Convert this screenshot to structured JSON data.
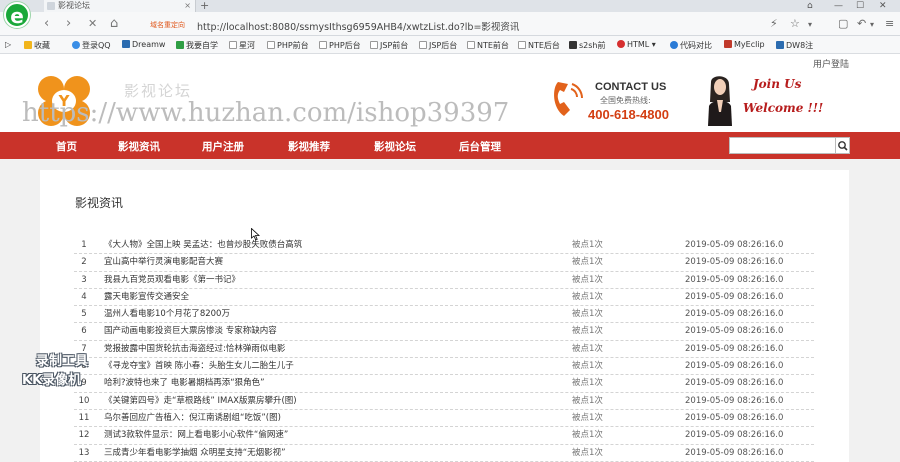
{
  "browser": {
    "logo_glyph": "e",
    "tab_title": "影视论坛",
    "tab_close": "×",
    "new_tab": "+",
    "window_controls": [
      "⌂",
      "—",
      "☐",
      "✕"
    ],
    "nav": {
      "back": "‹",
      "forward": "›",
      "stop": "✕",
      "home": "⌂"
    },
    "secure_badge": "域名重定向",
    "url": "http://localhost:8080/ssmysIthsg6959AHB4/xwtzList.do?lb=影视资讯",
    "toolbar_icons": [
      "⚡",
      "☆",
      "▾",
      "▢",
      "↶",
      "▾",
      "≡"
    ],
    "bookmarks": [
      {
        "label": "收藏",
        "color": "#f1b51c"
      },
      {
        "label": "登录QQ",
        "color": "#3a8ee6"
      },
      {
        "label": "Dreamw",
        "color": "#2b6cb0"
      },
      {
        "label": "我要自学",
        "color": "#2f9e44"
      },
      {
        "label": "星河",
        "color": "#999999"
      },
      {
        "label": "PHP前台",
        "color": "#999999"
      },
      {
        "label": "PHP后台",
        "color": "#999999"
      },
      {
        "label": "JSP前台",
        "color": "#999999"
      },
      {
        "label": "JSP后台",
        "color": "#999999"
      },
      {
        "label": "NTE前台",
        "color": "#999999"
      },
      {
        "label": "NTE后台",
        "color": "#999999"
      },
      {
        "label": "s2sh前",
        "color": "#333333"
      },
      {
        "label": "HTML",
        "color": "#d62f2f"
      },
      {
        "label": "代码对比",
        "color": "#2b7bd6"
      },
      {
        "label": "MyEclip",
        "color": "#c0392b"
      },
      {
        "label": "DW8注",
        "color": "#2b6cb0"
      }
    ]
  },
  "header": {
    "login_link": "用户登陆",
    "site_title": "影视论坛",
    "logo_char": "Y",
    "watermark": "https://www.huzhan.com/ishop39397",
    "contact_title": "CONTACT US",
    "contact_sub": "全国免费热线:",
    "contact_phone": "400-618-4800",
    "join_title": "Join Us",
    "welcome_title": "Welcome !!!"
  },
  "nav": {
    "items": [
      "首页",
      "影视资讯",
      "用户注册",
      "影视推荐",
      "影视论坛",
      "后台管理"
    ],
    "search_placeholder": "",
    "search_icon": "⚲"
  },
  "content": {
    "section_title": "影视资讯",
    "rows": [
      {
        "no": "1",
        "title": "《大人物》全国上映 吴孟达：也曾炒股失败债台高筑",
        "hits": "被点1次",
        "time": "2019-05-09 08:26:16.0"
      },
      {
        "no": "2",
        "title": "宜山高中举行灵演电影配音大赛",
        "hits": "被点1次",
        "time": "2019-05-09 08:26:16.0"
      },
      {
        "no": "3",
        "title": "我县九百党员观看电影《第一书记》",
        "hits": "被点1次",
        "time": "2019-05-09 08:26:16.0"
      },
      {
        "no": "4",
        "title": "露天电影宣传交通安全",
        "hits": "被点1次",
        "time": "2019-05-09 08:26:16.0"
      },
      {
        "no": "5",
        "title": "温州人看电影10个月花了8200万",
        "hits": "被点1次",
        "time": "2019-05-09 08:26:16.0"
      },
      {
        "no": "6",
        "title": "国产动画电影投资巨大票房惨淡 专家称缺内容",
        "hits": "被点1次",
        "time": "2019-05-09 08:26:16.0"
      },
      {
        "no": "7",
        "title": "党报披露中国货轮抗击海盗经过:恰林弹雨似电影",
        "hits": "被点1次",
        "time": "2019-05-09 08:26:16.0"
      },
      {
        "no": "8",
        "title": "《寻龙夺宝》首映 陈小春：头胎生女儿二胎生儿子",
        "hits": "被点1次",
        "time": "2019-05-09 08:26:16.0"
      },
      {
        "no": "9",
        "title": "哈利?波特也来了 电影暑期档再添“狠角色”",
        "hits": "被点1次",
        "time": "2019-05-09 08:26:16.0"
      },
      {
        "no": "10",
        "title": "《关键第四号》走“草根路线” IMAX版票房攀升(图)",
        "hits": "被点1次",
        "time": "2019-05-09 08:26:16.0"
      },
      {
        "no": "11",
        "title": "乌尔善回应广告植入：倪江南诱剧组“吃饭”(图)",
        "hits": "被点1次",
        "time": "2019-05-09 08:26:16.0"
      },
      {
        "no": "12",
        "title": "测试3款软件显示：网上看电影小心软件“偷网速”",
        "hits": "被点1次",
        "time": "2019-05-09 08:26:16.0"
      },
      {
        "no": "13",
        "title": "三成青少年看电影学抽烟 众明星支持“无烟影视”",
        "hits": "被点1次",
        "time": "2019-05-09 08:26:16.0"
      }
    ]
  },
  "overlay": {
    "rec_line1": "录制工具",
    "rec_line2": "KK录像机"
  },
  "colors": {
    "nav_red": "#c9332a",
    "accent_orange": "#f0931c",
    "phone_red": "#d33e12"
  }
}
